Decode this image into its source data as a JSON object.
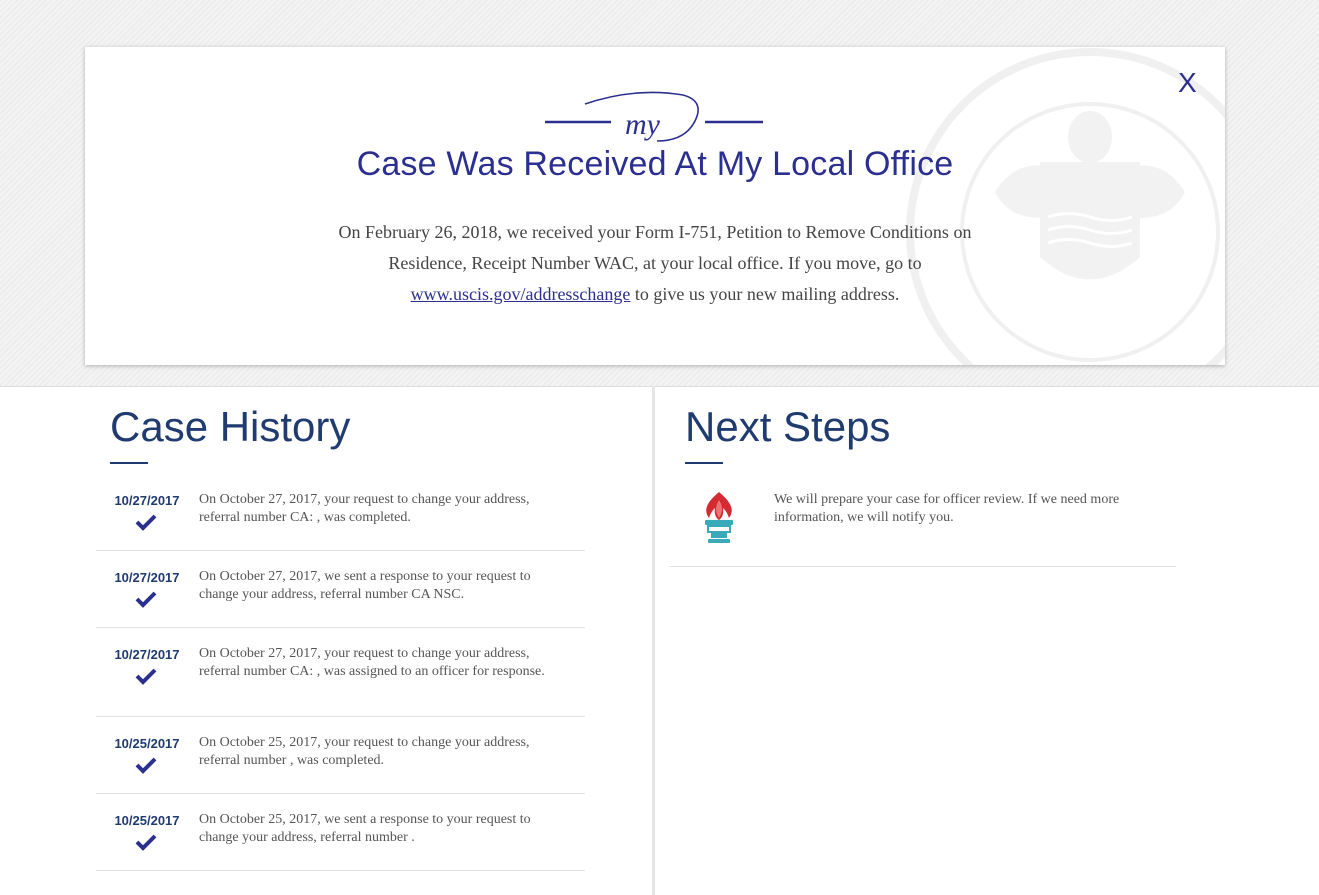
{
  "status": {
    "logo_text": "my",
    "title": "Case Was Received At My Local Office",
    "body_before": "On February 26, 2018, we received your Form I-751, Petition to Remove Conditions on Residence, Receipt Number WAC",
    "body_middle": ", at your local office. If you move, go to ",
    "link_text": "www.uscis.gov/addresschange",
    "body_after": " to give us your new mailing address.",
    "close_label": "X"
  },
  "case_history": {
    "title": "Case History",
    "items": [
      {
        "date": "10/27/2017",
        "text": "On October 27, 2017, your request to change your address, referral number CA:                              , was completed."
      },
      {
        "date": "10/27/2017",
        "text": "On October 27, 2017, we sent a response to your request to change your address, referral number CA                          NSC."
      },
      {
        "date": "10/27/2017",
        "text": "On October 27, 2017, your request to change your address, referral number CA:                     , was assigned to an officer for response."
      },
      {
        "date": "10/25/2017",
        "text": "On October 25, 2017, your request to change your address, referral number                                      , was completed."
      },
      {
        "date": "10/25/2017",
        "text": "On October 25, 2017, we sent a response to your request to change your address, referral number                                     ."
      }
    ]
  },
  "next_steps": {
    "title": "Next Steps",
    "text": "We will prepare your case for officer review.  If we need more information, we will notify you."
  },
  "colors": {
    "brand_navy": "#2b2f8f",
    "heading_blue": "#1f3b6f",
    "torch_red": "#d42a32",
    "torch_teal": "#3aa9b8"
  },
  "icons": [
    "close-icon",
    "seal-icon",
    "check-icon",
    "torch-icon"
  ]
}
